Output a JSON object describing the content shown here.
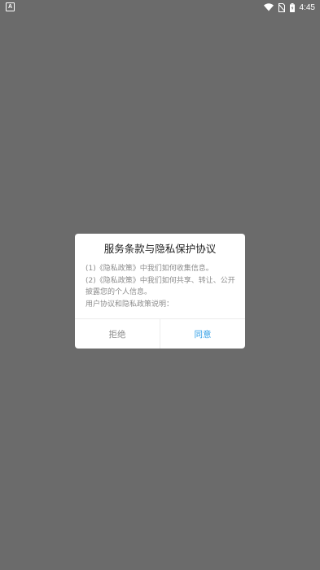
{
  "status_bar": {
    "app_badge": "A",
    "time": "4:45"
  },
  "dialog": {
    "title": "服务条款与隐私保护协议",
    "lines": [
      "(1)《隐私政策》中我们如何收集信息。",
      "(2)《隐私政策》中我们如何共享、转让、公开披露您的个人信息。",
      "用户协议和隐私政策说明："
    ],
    "reject_label": "拒绝",
    "agree_label": "同意"
  },
  "colors": {
    "overlay": "#6b6b6b",
    "dialog_bg": "#ffffff",
    "accent": "#2e9de6",
    "muted_text": "#8c8c8c"
  },
  "icons": [
    "app-badge-icon",
    "wifi-icon",
    "no-sim-icon",
    "battery-icon"
  ]
}
